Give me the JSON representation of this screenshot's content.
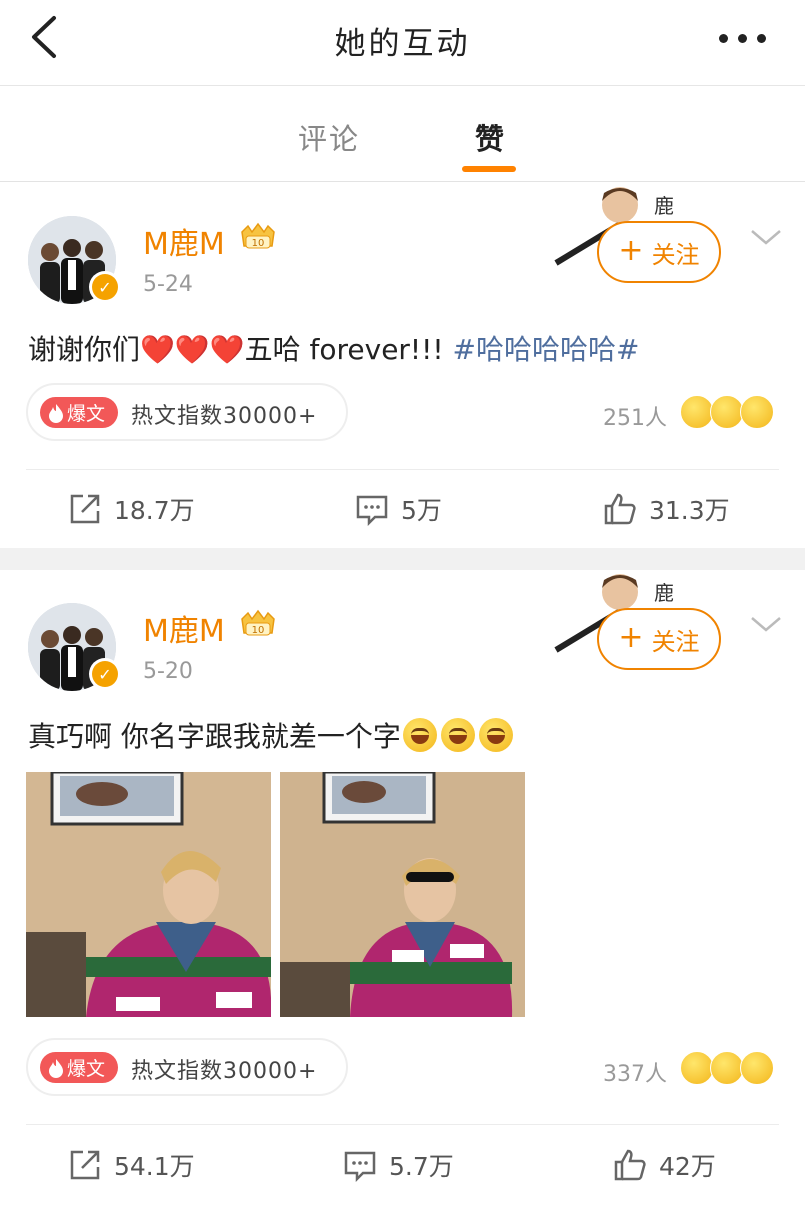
{
  "header": {
    "title": "她的互动"
  },
  "tabs": [
    {
      "label": "评论",
      "active": false
    },
    {
      "label": "赞",
      "active": true
    }
  ],
  "colors": {
    "accent": "#ff8200",
    "username": "#f08300",
    "hashtag": "#4f6e9e",
    "hot_badge": "#f25858"
  },
  "posts": [
    {
      "username": "M鹿M",
      "date": "5-24",
      "follow_label": "关注",
      "text_main": "谢谢你们",
      "hearts": "❤️❤️❤️",
      "text_after": "五哈 forever!!!",
      "hashtag": "#哈哈哈哈哈#",
      "hot_badge": "爆文",
      "hot_label": "热文指数30000+",
      "reactions_count": "251人",
      "actions": {
        "share": "18.7万",
        "comment": "5万",
        "like": "31.3万"
      }
    },
    {
      "username": "M鹿M",
      "date": "5-20",
      "follow_label": "关注",
      "text_main": "真巧啊 你名字跟我就差一个字",
      "hot_badge": "爆文",
      "hot_label": "热文指数30000+",
      "reactions_count": "337人",
      "actions": {
        "share": "54.1万",
        "comment": "5.7万",
        "like": "42万"
      }
    }
  ]
}
